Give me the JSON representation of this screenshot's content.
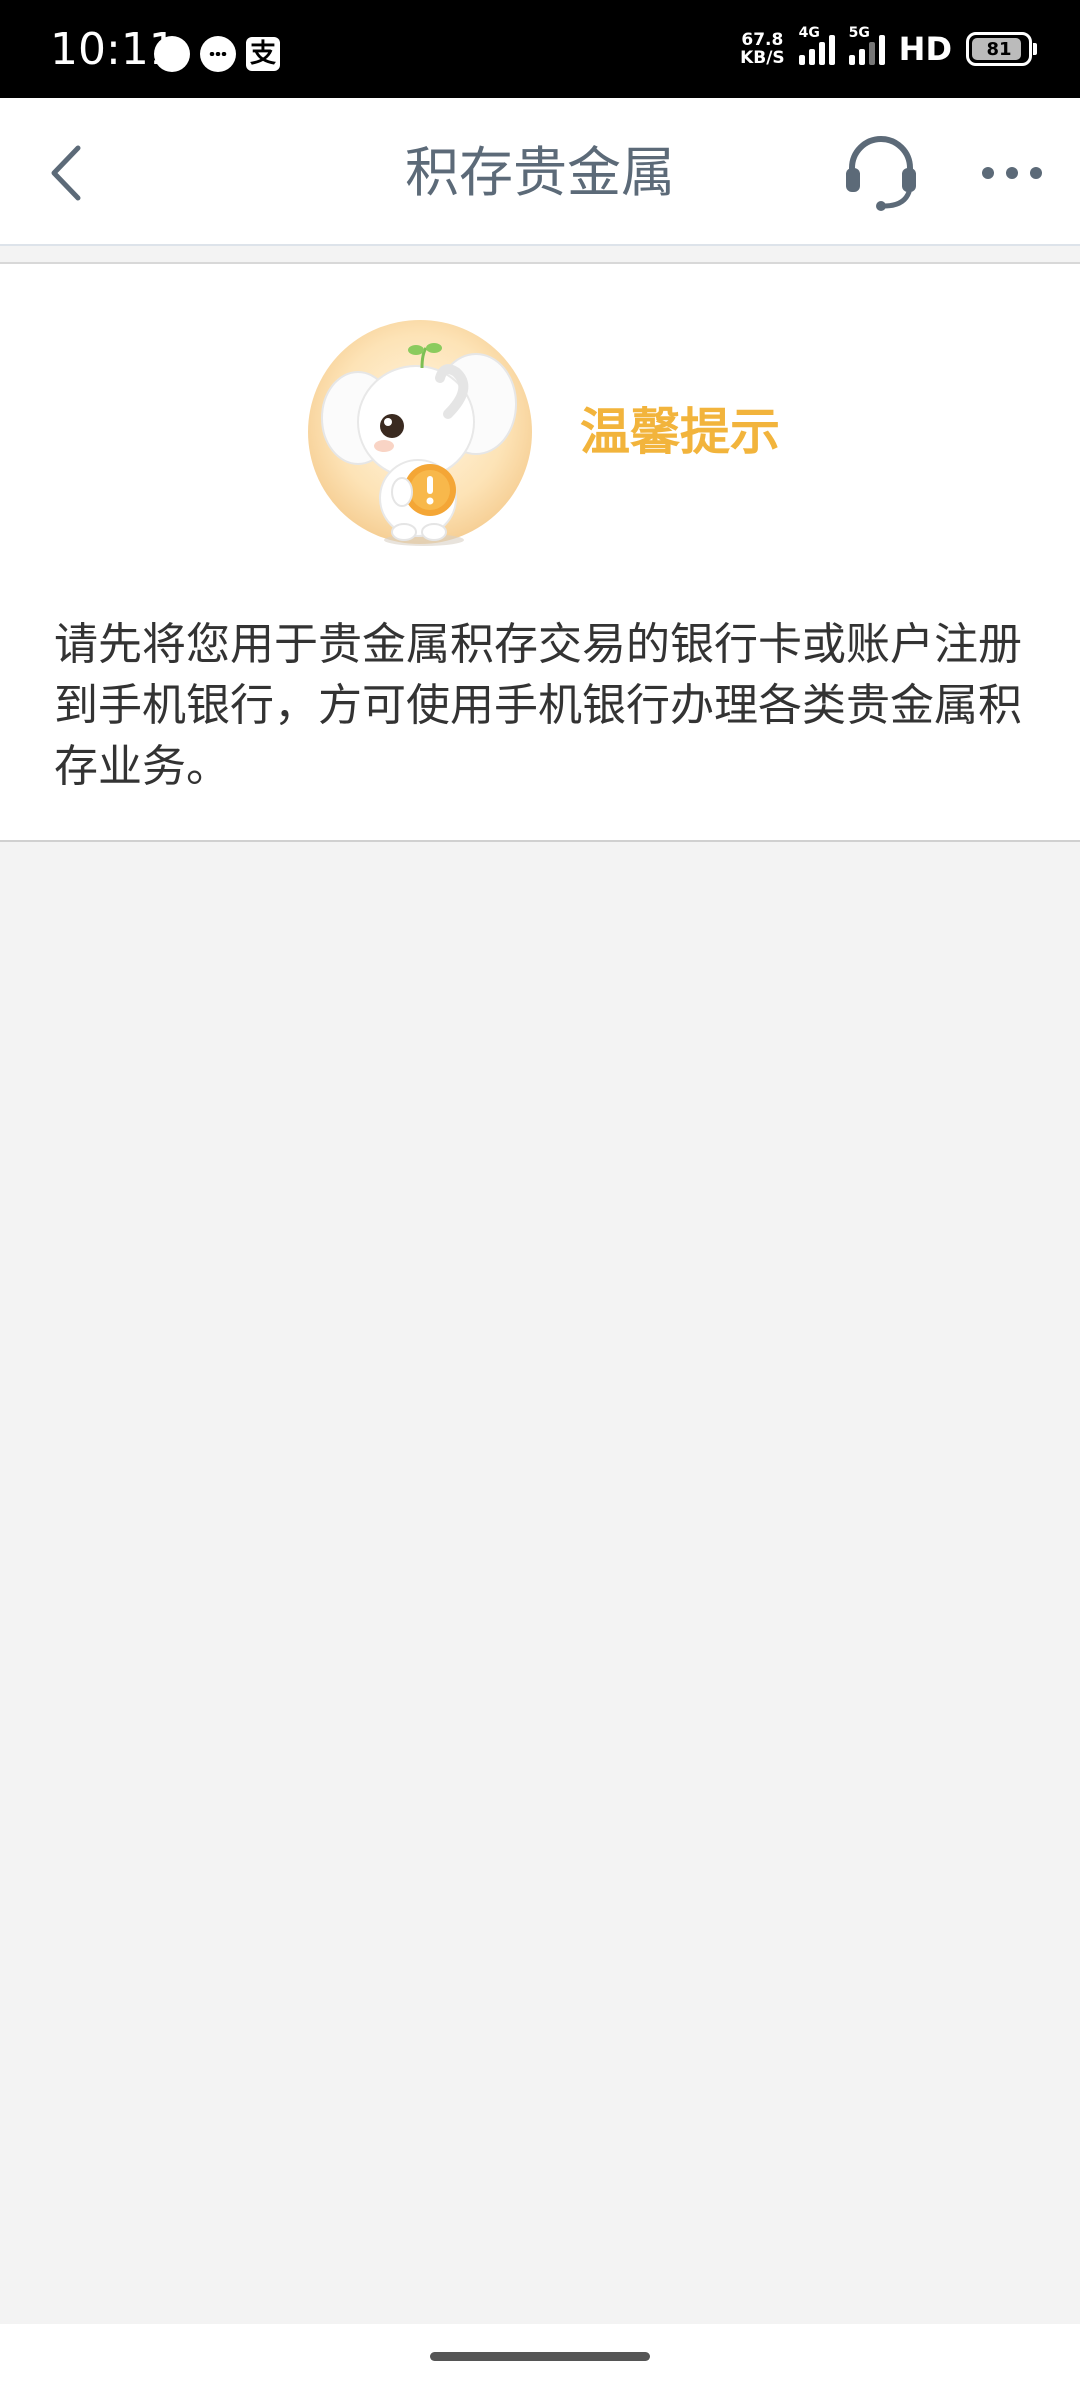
{
  "status_bar": {
    "time": "10:11",
    "net_speed_value": "67.8",
    "net_speed_unit": "KB/S",
    "network_1": "4G",
    "network_2": "5G",
    "hd": "HD",
    "battery_level": "81"
  },
  "header": {
    "title": "积存贵金属",
    "back_icon": "chevron-left-icon",
    "support_icon": "headset-icon",
    "more_icon": "more-dots-icon"
  },
  "notice": {
    "title": "温馨提示",
    "body": "请先将您用于贵金属积存交易的银行卡或账户注册到手机银行，方可使用手机银行办理各类贵金属积存业务。",
    "title_color": "#f2b43c"
  },
  "colors": {
    "header_text": "#5c6a78",
    "background": "#f3f3f3"
  }
}
